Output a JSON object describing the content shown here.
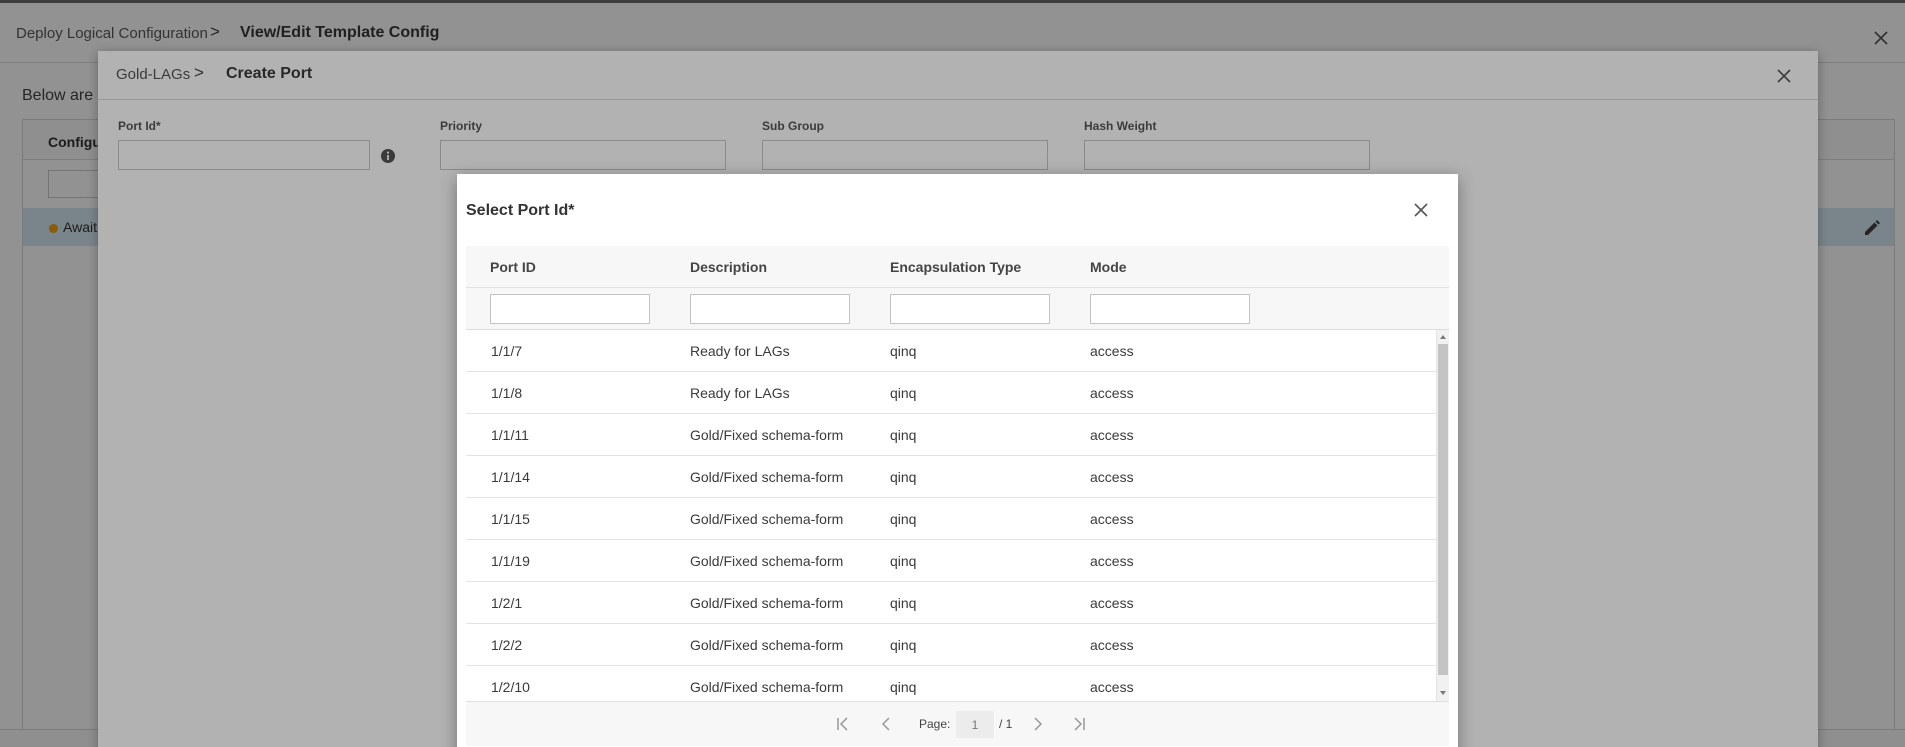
{
  "page": {
    "breadcrumb_parent": "Deploy Logical Configuration",
    "breadcrumb_separator": ">",
    "breadcrumb_current": "View/Edit Template Config",
    "intro_text": "Below are t",
    "table_header_partial": "Configu",
    "row_status_partial": "Awaiti"
  },
  "create_port": {
    "breadcrumb_parent": "Gold-LAGs",
    "breadcrumb_separator": ">",
    "breadcrumb_current": "Create Port",
    "fields": {
      "port_id_label": "Port Id*",
      "priority_label": "Priority",
      "sub_group_label": "Sub Group",
      "hash_weight_label": "Hash Weight"
    }
  },
  "select_port": {
    "title": "Select Port Id*",
    "columns": [
      "Port ID",
      "Description",
      "Encapsulation Type",
      "Mode"
    ],
    "rows": [
      [
        "1/1/7",
        "Ready for LAGs",
        "qinq",
        "access"
      ],
      [
        "1/1/8",
        "Ready for LAGs",
        "qinq",
        "access"
      ],
      [
        "1/1/11",
        "Gold/Fixed schema-form",
        "qinq",
        "access"
      ],
      [
        "1/1/14",
        "Gold/Fixed schema-form",
        "qinq",
        "access"
      ],
      [
        "1/1/15",
        "Gold/Fixed schema-form",
        "qinq",
        "access"
      ],
      [
        "1/1/19",
        "Gold/Fixed schema-form",
        "qinq",
        "access"
      ],
      [
        "1/2/1",
        "Gold/Fixed schema-form",
        "qinq",
        "access"
      ],
      [
        "1/2/2",
        "Gold/Fixed schema-form",
        "qinq",
        "access"
      ],
      [
        "1/2/10",
        "Gold/Fixed schema-form",
        "qinq",
        "access"
      ]
    ],
    "pager": {
      "page_label": "Page:",
      "current_page": "1",
      "total": "/ 1"
    }
  },
  "colors": {
    "status_pending": "#f0a20a",
    "selected_row": "#d6e9f5",
    "icon_gray": "#555555"
  }
}
